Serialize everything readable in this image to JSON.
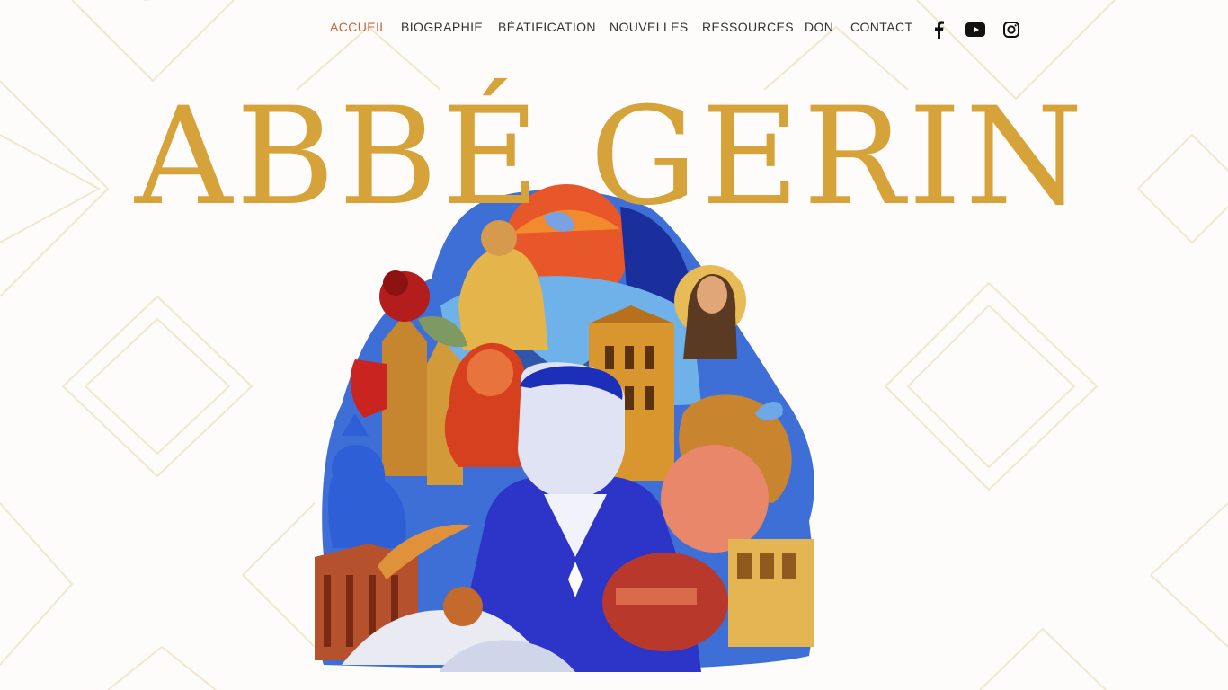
{
  "nav": {
    "items": [
      {
        "label": "ACCUEIL",
        "active": true
      },
      {
        "label": "BIOGRAPHIE",
        "active": false
      },
      {
        "label": "BÉATIFICATION",
        "active": false
      },
      {
        "label": "NOUVELLES",
        "active": false
      },
      {
        "label": "RESSOURCES",
        "active": false
      },
      {
        "label": "DON",
        "active": false
      },
      {
        "label": "CONTACT",
        "active": false
      }
    ],
    "social": [
      "facebook-icon",
      "youtube-icon",
      "instagram-icon"
    ]
  },
  "hero": {
    "title": "ABBÉ GERIN"
  },
  "colors": {
    "accent": "#c8643c",
    "title": "#d6a23a",
    "text": "#333333",
    "background": "#fdfcfa"
  }
}
